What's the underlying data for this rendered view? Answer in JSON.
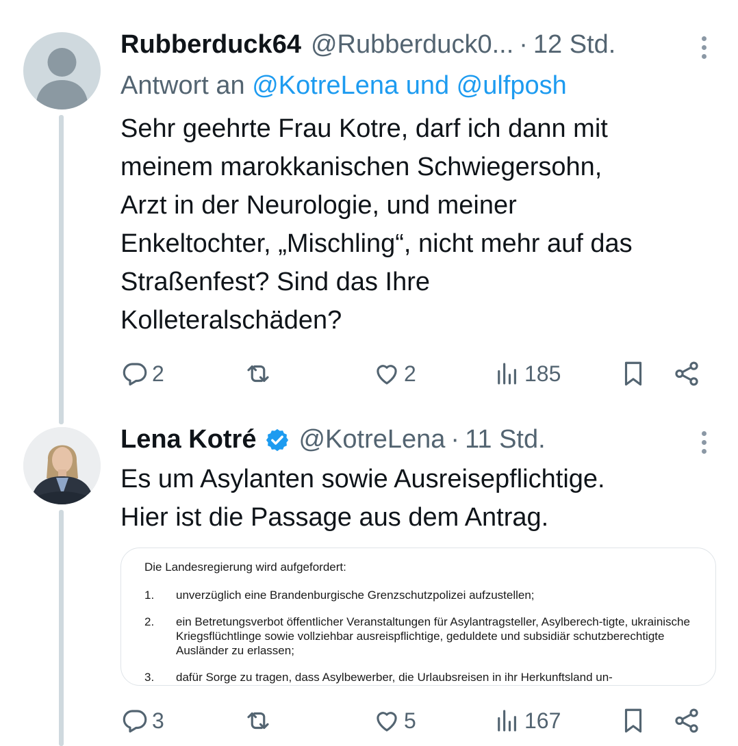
{
  "tweets": [
    {
      "name": "Rubberduck64",
      "handle": "@Rubberduck0...",
      "time": "12 Std.",
      "reply_prefix": "Antwort an",
      "reply_to": "@KotreLena und @ulfposh",
      "text_lines": [
        "Sehr geehrte Frau Kotre, darf ich dann mit",
        "meinem marokkanischen Schwiegersohn,",
        "Arzt in der Neurologie, und meiner",
        "Enkeltochter, „Mischling“, nicht mehr auf das",
        "Straßenfest? Sind das Ihre",
        "Kolleteralschäden?"
      ],
      "replies": "2",
      "reposts": "",
      "likes": "2",
      "views": "185"
    },
    {
      "name": "Lena Kotré",
      "verified": true,
      "handle": "@KotreLena",
      "time": "11 Std.",
      "text_lines": [
        "Es um Asylanten sowie Ausreisepflichtige.",
        "Hier ist die Passage aus dem Antrag."
      ],
      "document": {
        "lead": "Die Landesregierung wird aufgefordert:",
        "items": [
          {
            "num": "1.",
            "text": "unverzüglich eine Brandenburgische Grenzschutzpolizei aufzustellen;"
          },
          {
            "num": "2.",
            "text": "ein Betretungsverbot öffentlicher Veranstaltungen für Asylantragsteller, Asylberech-tigte, ukrainische Kriegsflüchtlinge sowie vollziehbar ausreispflichtige, geduldete und subsidiär schutzberechtigte Ausländer zu erlassen;"
          },
          {
            "num": "3.",
            "text": "dafür Sorge zu tragen, dass Asylbewerber, die Urlaubsreisen in ihr Herkunftsland un-"
          }
        ]
      },
      "replies": "3",
      "reposts": "",
      "likes": "5",
      "views": "167"
    }
  ],
  "colors": {
    "text": "#0f1419",
    "secondary": "#536471",
    "link": "#1d9bf0",
    "verified": "#1d9bf0",
    "thread_line": "#cfd9de"
  },
  "icons": [
    "default-avatar-icon",
    "more-icon",
    "reply-icon",
    "repost-icon",
    "like-icon",
    "views-icon",
    "bookmark-icon",
    "share-icon",
    "verified-badge-icon"
  ]
}
